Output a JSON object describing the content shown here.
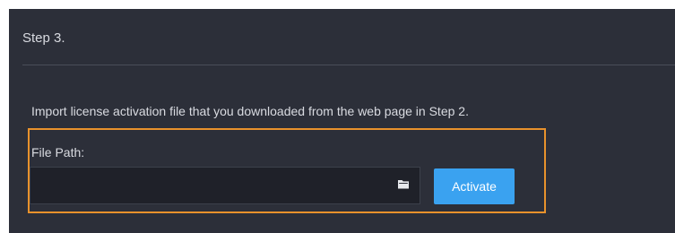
{
  "step": {
    "title": "Step 3."
  },
  "instruction": "Import license activation file that you downloaded from the web page in Step 2.",
  "file_path": {
    "label": "File Path:",
    "value": "",
    "placeholder": "",
    "browse_icon": "folder-icon"
  },
  "activate_button": {
    "label": "Activate"
  },
  "colors": {
    "panel_background": "#2c2f39",
    "input_background": "#1f2129",
    "accent_button": "#3aa2f0",
    "highlight_border": "#e8922c",
    "text": "#d9dbe1"
  }
}
